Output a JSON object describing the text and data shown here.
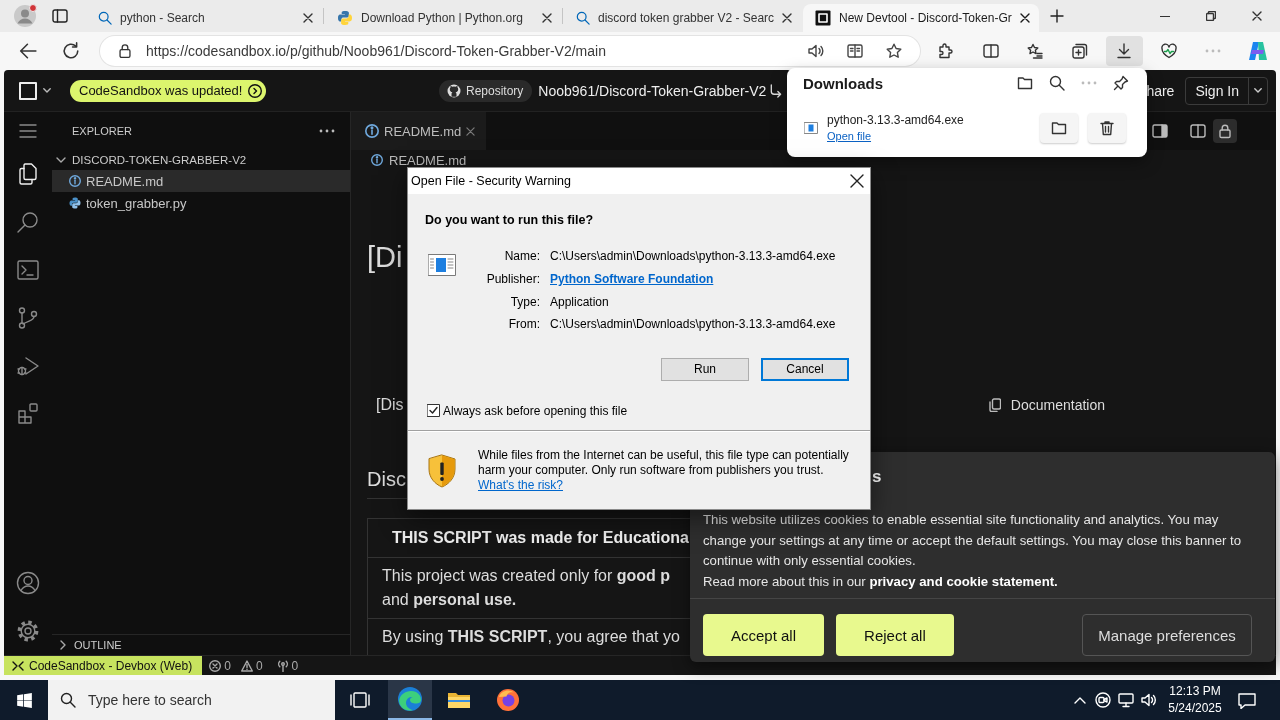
{
  "browser": {
    "tabs": [
      {
        "kind": "search",
        "title": "python - Search",
        "selected": false
      },
      {
        "kind": "python",
        "title": "Download Python | Python.org",
        "selected": false
      },
      {
        "kind": "search",
        "title": "discord token grabber V2 - Searc",
        "selected": false
      },
      {
        "kind": "sandbox",
        "title": "New Devtool - Discord-Token-Gr",
        "selected": true
      }
    ],
    "url": "https://codesandbox.io/p/github/Noob961/Discord-Token-Grabber-V2/main",
    "downloads_button": {
      "selected": true
    }
  },
  "downloads_panel": {
    "title": "Downloads",
    "items": [
      {
        "file_name": "python-3.13.3-amd64.exe",
        "action": "Open file"
      }
    ]
  },
  "sandbox": {
    "update_badge": "CodeSandbox was updated!",
    "repository_button": "Repository",
    "repo_name": "Noob961/Discord-Token-Grabber-V2",
    "share_button": "hare",
    "sign_in_button": "Sign In",
    "activity_bar": {
      "top": [
        {
          "kind": "files",
          "selected": true
        },
        {
          "kind": "search",
          "selected": false
        },
        {
          "kind": "terminal",
          "selected": false
        },
        {
          "kind": "source_control",
          "selected": false
        },
        {
          "kind": "run_debug",
          "selected": false
        },
        {
          "kind": "extensions",
          "selected": false
        }
      ],
      "bottom": [
        {
          "kind": "account",
          "selected": false
        },
        {
          "kind": "settings",
          "selected": false
        }
      ]
    },
    "explorer": {
      "title": "EXPLORER",
      "tree": [
        {
          "label": "DISCORD-TOKEN-GRABBER-V2",
          "expanded": true,
          "children": [
            {
              "label": "README.md",
              "kind": "info",
              "selected": true
            },
            {
              "label": "token_grabber.py",
              "kind": "python",
              "selected": false
            }
          ]
        }
      ],
      "outline": {
        "label": "OUTLINE",
        "expanded": false
      }
    },
    "editor": {
      "tabs": [
        {
          "label": "README.md",
          "selected": true
        }
      ],
      "actions": [
        {
          "kind": "panel",
          "selected": false
        },
        {
          "kind": "split",
          "selected": false
        },
        {
          "kind": "lock",
          "selected": true
        }
      ],
      "breadcrumb": "README.md",
      "preview": {
        "title": "[Di",
        "badge_text": "[Dis",
        "documentation_link": "Documentation",
        "section_heading": "Disc",
        "table": {
          "header": "THIS SCRIPT was made for Educationa",
          "rows": [
            "This project was created only for **good p**\nand **personal use.**",
            "By using **THIS SCRIPT**, you agree that yo"
          ]
        }
      }
    },
    "status_bar": {
      "remote": "CodeSandbox - Devbox (Web)",
      "errors": "0",
      "warnings": "0",
      "ports": "0"
    }
  },
  "dialog": {
    "title": "Open File - Security Warning",
    "question": "Do you want to run this file?",
    "fields": [
      {
        "label": "Name:",
        "value": "C:\\Users\\admin\\Downloads\\python-3.13.3-amd64.exe",
        "kind": "text"
      },
      {
        "label": "Publisher:",
        "value": "Python Software Foundation",
        "kind": "link"
      },
      {
        "label": "Type:",
        "value": "Application",
        "kind": "text"
      },
      {
        "label": "From:",
        "value": "C:\\Users\\admin\\Downloads\\python-3.13.3-amd64.exe",
        "kind": "text"
      }
    ],
    "buttons": [
      {
        "label": "Run",
        "focused": false
      },
      {
        "label": "Cancel",
        "focused": true
      }
    ],
    "checkbox": {
      "label": "Always ask before opening this file",
      "checked": true
    },
    "warning": "While files from the Internet can be useful, this file type can potentially harm your computer. Only run software from publishers you trust.",
    "risk_link": "What's the risk?"
  },
  "cookie_banner": {
    "heading": "s",
    "text": "This website utilizes cookies to enable essential site functionality and analytics. You may change your settings at any time or accept the default settings. You may close this banner to continue with only essential cookies.",
    "more_text": "Read more about this in our",
    "link": "privacy and cookie statement.",
    "buttons": [
      {
        "label": "Accept all",
        "kind": "primary"
      },
      {
        "label": "Reject all",
        "kind": "primary"
      },
      {
        "label": "Manage preferences",
        "kind": "outline"
      }
    ]
  },
  "taskbar": {
    "search_placeholder": "Type here to search",
    "apps": [
      {
        "kind": "edge",
        "selected": true
      },
      {
        "kind": "explorer",
        "selected": false
      },
      {
        "kind": "firefox",
        "selected": false
      }
    ],
    "time": "12:13 PM",
    "date": "5/24/2025"
  }
}
